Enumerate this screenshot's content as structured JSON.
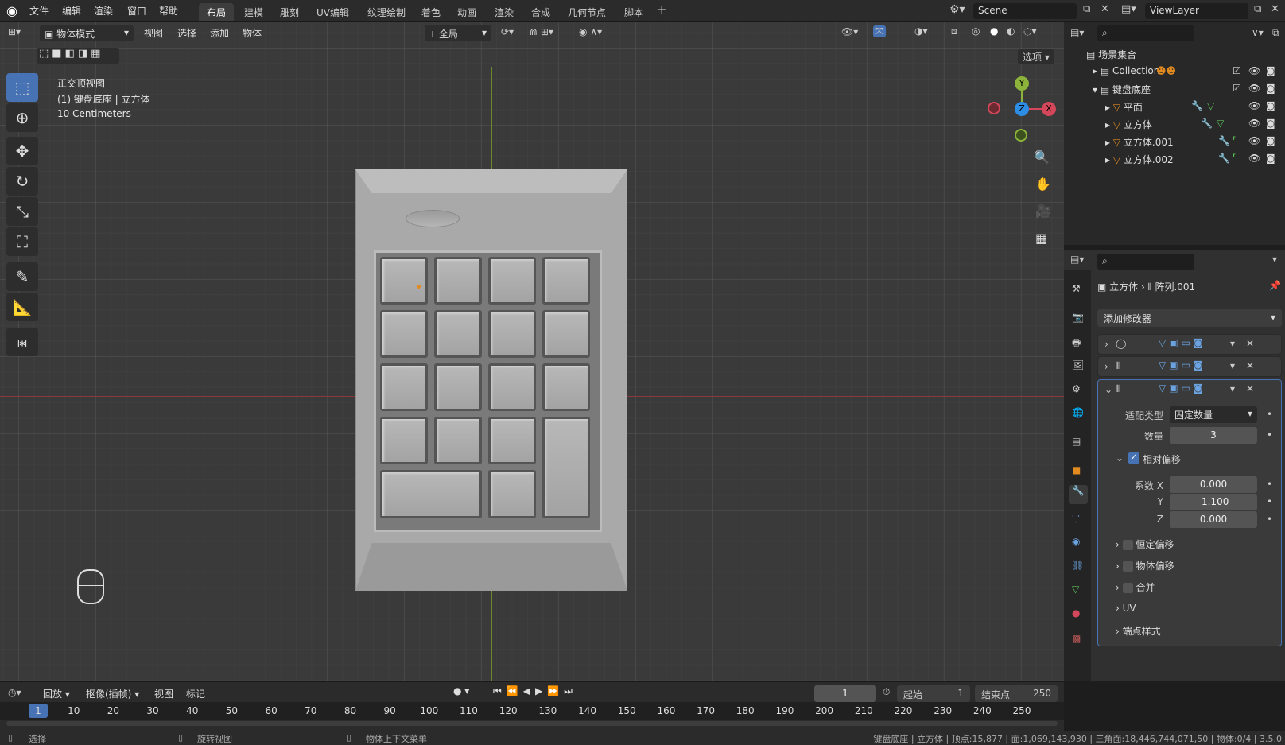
{
  "topbar": {
    "menus": [
      "文件",
      "编辑",
      "渲染",
      "窗口",
      "帮助"
    ],
    "tabs": [
      "布局",
      "建模",
      "雕刻",
      "UV编辑",
      "纹理绘制",
      "着色",
      "动画",
      "渲染",
      "合成",
      "几何节点",
      "脚本"
    ],
    "add": "+",
    "scene": "Scene",
    "viewlayer": "ViewLayer"
  },
  "viewport_header": {
    "mode": "物体模式",
    "menus": [
      "视图",
      "选择",
      "添加",
      "物体"
    ],
    "transform": "全局",
    "options": "选项"
  },
  "viewport": {
    "view_name": "正交顶视图",
    "object_info": "(1) 键盘底座 | 立方体",
    "scale": "10 Centimeters",
    "gizmo": {
      "y": "Y",
      "z": "Z",
      "x": "X"
    }
  },
  "outliner": {
    "root": "场景集合",
    "items": [
      {
        "name": "Collection",
        "level": 1
      },
      {
        "name": "键盘底座",
        "level": 1
      },
      {
        "name": "平面",
        "level": 2
      },
      {
        "name": "立方体",
        "level": 2
      },
      {
        "name": "立方体.001",
        "level": 2
      },
      {
        "name": "立方体.002",
        "level": 2
      }
    ]
  },
  "properties": {
    "breadcrumb_obj": "立方体",
    "breadcrumb_mod": "阵列.001",
    "add_modifier": "添加修改器",
    "fit_type_label": "适配类型",
    "fit_type_value": "固定数量",
    "count_label": "数量",
    "count_value": "3",
    "relative_offset": "相对偏移",
    "factor_x_label": "系数 X",
    "factor_x": "0.000",
    "factor_y_label": "Y",
    "factor_y": "-1.100",
    "factor_z_label": "Z",
    "factor_z": "0.000",
    "sections": [
      "恒定偏移",
      "物体偏移",
      "合并",
      "UV",
      "端点样式"
    ]
  },
  "timeline": {
    "playback": "回放",
    "keying": "抠像(插帧)",
    "view": "视图",
    "marker": "标记",
    "current_frame": "1",
    "start_label": "起始",
    "start": "1",
    "end_label": "结束点",
    "end": "250",
    "ticks": [
      "1",
      "10",
      "20",
      "30",
      "40",
      "50",
      "60",
      "70",
      "80",
      "90",
      "100",
      "110",
      "120",
      "130",
      "140",
      "150",
      "160",
      "170",
      "180",
      "190",
      "200",
      "210",
      "220",
      "230",
      "240",
      "250"
    ]
  },
  "statusbar": {
    "select": "选择",
    "rotate": "旋转视图",
    "context": "物体上下文菜单",
    "stats": "键盘底座 | 立方体 | 顶点:15,877 | 面:1,069,143,930 | 三角面:18,446,744,071,50 | 物体:0/4 | 3.5.0"
  }
}
